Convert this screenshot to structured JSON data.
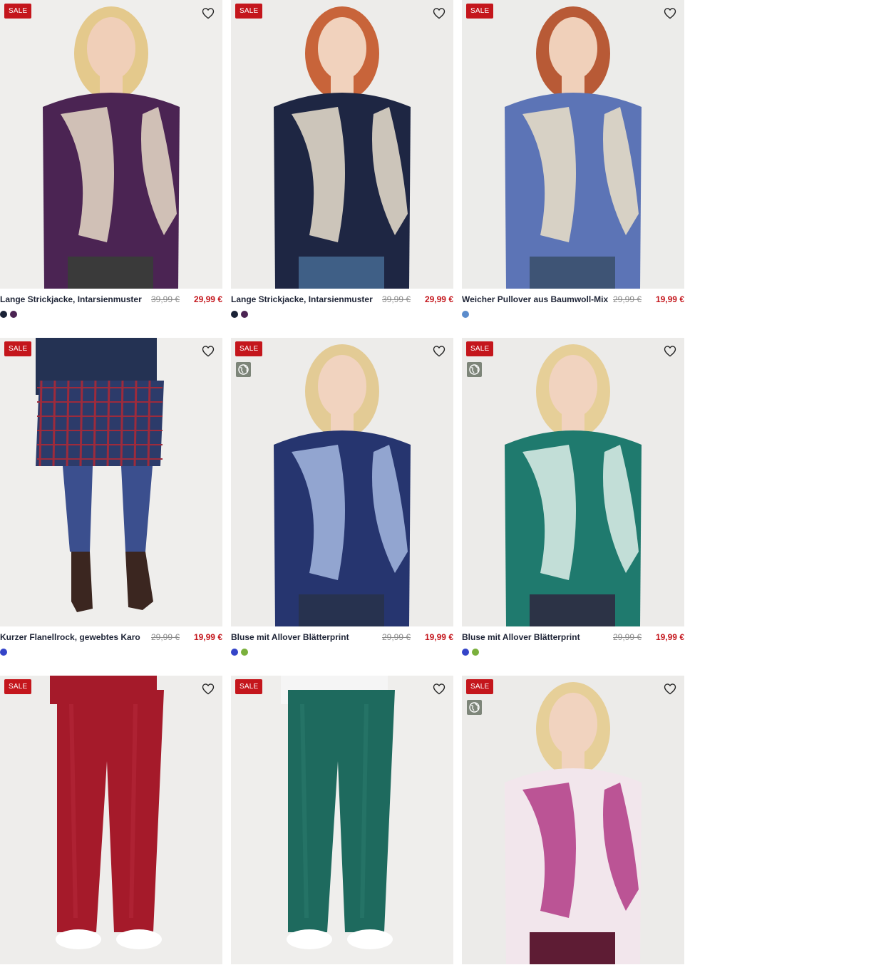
{
  "colors": {
    "sale": "#c4161c",
    "title": "#1e2436",
    "old_price": "#8a8a8a",
    "eco_badge_bg": "#7d8579"
  },
  "products": [
    {
      "sale_label": "SALE",
      "name": "Lange Strickjacke, Intarsienmuster",
      "old_price": "39,99 €",
      "price": "29,99 €",
      "eco": false,
      "swatches": [
        "#1a2236",
        "#4b2453"
      ],
      "art": {
        "bg": "#efeeec",
        "main": "#4b2453",
        "accent": "#e8dcc8",
        "bottom": "#3a3a3a",
        "skin": "#f0cfb8",
        "hair": "#e4c98c"
      }
    },
    {
      "sale_label": "SALE",
      "name": "Lange Strickjacke, Intarsienmuster",
      "old_price": "39,99 €",
      "price": "29,99 €",
      "eco": false,
      "swatches": [
        "#1a2236",
        "#4b2453"
      ],
      "art": {
        "bg": "#edecea",
        "main": "#1e2643",
        "accent": "#ebe2cf",
        "bottom": "#3f5f86",
        "skin": "#f1d2bd",
        "hair": "#c8643a"
      }
    },
    {
      "sale_label": "SALE",
      "name": "Weicher Pullover aus Baumwoll-Mix",
      "old_price": "29,99 €",
      "price": "19,99 €",
      "eco": false,
      "swatches": [
        "#5b8ccc"
      ],
      "art": {
        "bg": "#ececea",
        "main": "#5c74b6",
        "accent": "#ece2c8",
        "bottom": "#3e5475",
        "skin": "#f0d0ba",
        "hair": "#b85a36"
      }
    },
    {
      "sale_label": "SALE",
      "name": "Kurzer Flanellrock, gewebtes Karo",
      "old_price": "29,99 €",
      "price": "19,99 €",
      "eco": false,
      "swatches": [
        "#3444c8"
      ],
      "art": {
        "bg": "#efeeec",
        "main": "#2c3b6a",
        "accent": "#9d2b3c",
        "bottom": "#3b4f8e",
        "skin": "#f0d0ba",
        "hair": "#2c2a28"
      }
    },
    {
      "sale_label": "SALE",
      "name": "Bluse mit Allover Blätterprint",
      "old_price": "29,99 €",
      "price": "19,99 €",
      "eco": true,
      "swatches": [
        "#3444c8",
        "#7ab03c"
      ],
      "art": {
        "bg": "#edecea",
        "main": "#26356f",
        "accent": "#a6b9e2",
        "bottom": "#27324f",
        "skin": "#f1d3bf",
        "hair": "#e3cb95"
      }
    },
    {
      "sale_label": "SALE",
      "name": "Bluse mit Allover Blätterprint",
      "old_price": "29,99 €",
      "price": "19,99 €",
      "eco": true,
      "swatches": [
        "#3444c8",
        "#7ab03c"
      ],
      "art": {
        "bg": "#ecebe9",
        "main": "#1f7a6e",
        "accent": "#dff0ea",
        "bottom": "#2c3346",
        "skin": "#f1d3bf",
        "hair": "#e6cf98"
      }
    },
    {
      "sale_label": "SALE",
      "name": "",
      "old_price": "",
      "price": "",
      "eco": false,
      "swatches": [],
      "art": {
        "bg": "#eeedeb",
        "main": "#a51a2a",
        "accent": "#b4283a",
        "bottom": "#a51a2a",
        "skin": "#f0d0ba",
        "hair": "#a51a2a"
      }
    },
    {
      "sale_label": "SALE",
      "name": "",
      "old_price": "",
      "price": "",
      "eco": false,
      "swatches": [],
      "art": {
        "bg": "#efeeec",
        "main": "#1e6a5e",
        "accent": "#2a7a6c",
        "bottom": "#1e6a5e",
        "skin": "#f0d0ba",
        "hair": "#f5f5f5"
      }
    },
    {
      "sale_label": "SALE",
      "name": "",
      "old_price": "",
      "price": "",
      "eco": true,
      "swatches": [],
      "art": {
        "bg": "#ecebe9",
        "main": "#f2e6ec",
        "accent": "#b23a86",
        "bottom": "#5e1c34",
        "skin": "#f1d3bf",
        "hair": "#e6cf98"
      }
    }
  ]
}
